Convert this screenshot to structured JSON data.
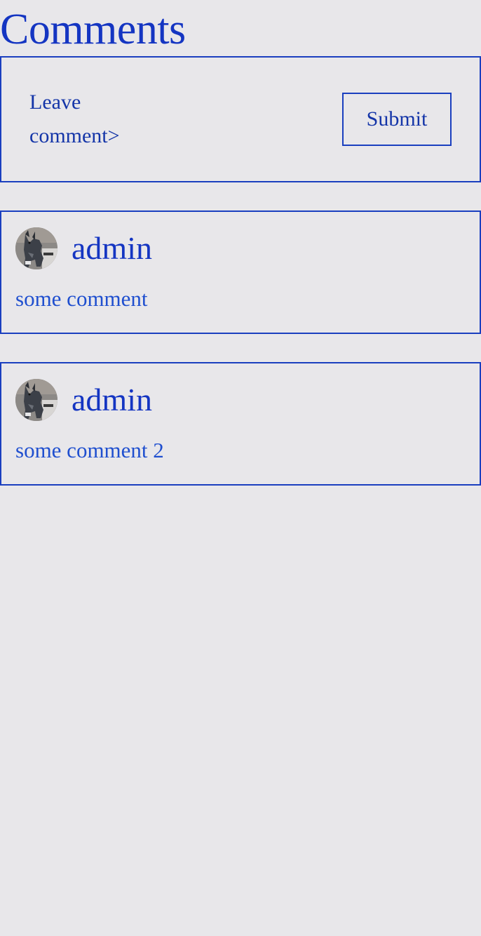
{
  "header": {
    "title": "Comments"
  },
  "composer": {
    "placeholder": "Leave\ncomment>",
    "submit_label": "Submit"
  },
  "comments": [
    {
      "author": "admin",
      "text": "some comment"
    },
    {
      "author": "admin",
      "text": "some comment 2"
    }
  ],
  "colors": {
    "background": "#e8e7ea",
    "accent": "#1a3fbf",
    "text": "#1435c2"
  },
  "icons": {
    "avatar": "dog-photo-avatar"
  }
}
